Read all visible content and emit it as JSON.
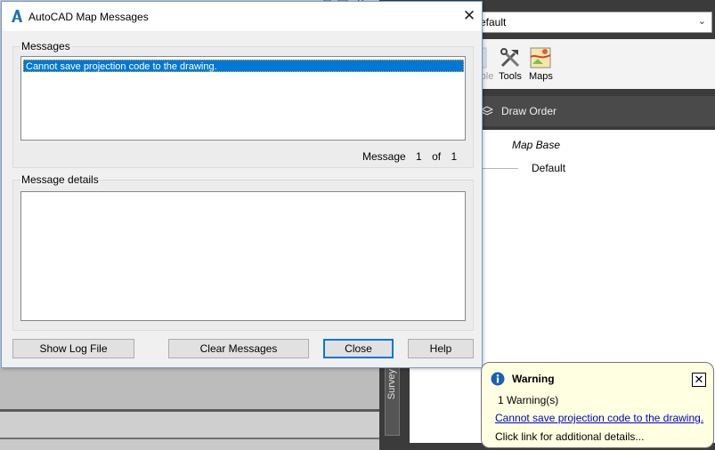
{
  "dialog": {
    "title": "AutoCAD Map Messages",
    "messages_group_label": "Messages",
    "messages": [
      "Cannot save projection code to the drawing."
    ],
    "counter": {
      "label": "Message",
      "current": "1",
      "of": "of",
      "total": "1"
    },
    "details_group_label": "Message details",
    "buttons": {
      "show_log": "Show Log File",
      "clear": "Clear Messages",
      "close": "Close",
      "help": "Help"
    }
  },
  "background": {
    "dropdown_value": "efault",
    "ribbon": {
      "partial_label": "ble",
      "tools": "Tools",
      "maps": "Maps"
    },
    "draw_order": "Draw Order",
    "tree": {
      "map_base": "Map Base",
      "default_item": "Default"
    },
    "survey_tab": "Survey"
  },
  "balloon": {
    "title": "Warning",
    "count": "1 Warning(s)",
    "link": "Cannot save projection code to the drawing.",
    "hint": "Click link for additional details..."
  }
}
